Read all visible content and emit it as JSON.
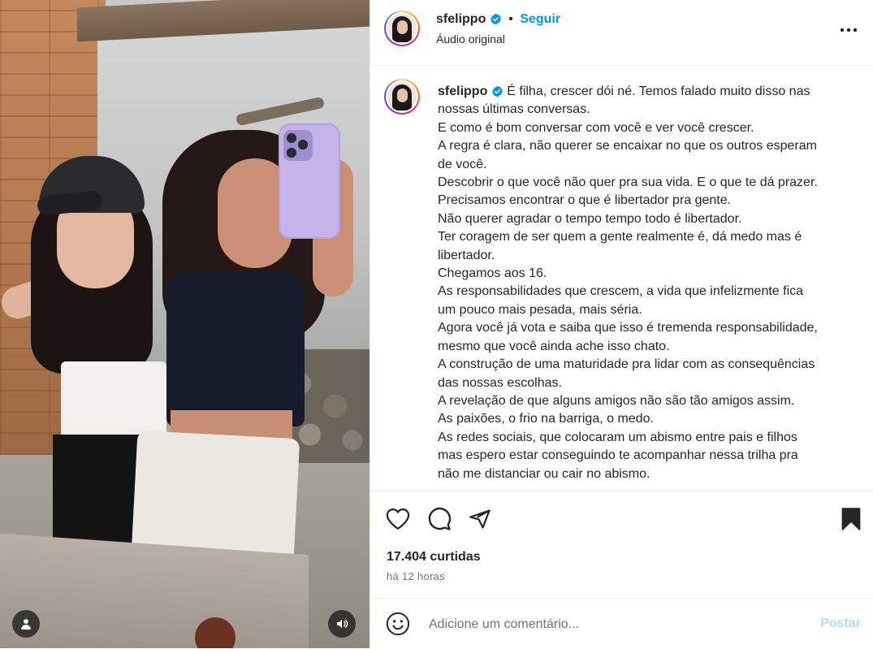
{
  "post": {
    "author": "sfelippo",
    "follow_label": "Seguir",
    "audio": "Áudio original",
    "more_label": "•••"
  },
  "caption": {
    "author": "sfelippo",
    "lines": [
      "É filha, crescer dói né. Temos falado muito disso nas",
      "nossas últimas conversas.",
      "E como é bom conversar com você e ver você crescer.",
      "A regra é clara, não querer se encaixar no que os outros esperam",
      "de você.",
      "Descobrir o que você não quer pra sua vida. E o que te dá prazer.",
      "Precisamos encontrar o que é libertador pra gente.",
      "Não querer agradar o tempo tempo todo é libertador.",
      "Ter coragem de ser quem a gente realmente é, dá medo mas é",
      "libertador.",
      "Chegamos aos 16.",
      "As responsabilidades que crescem, a vida que infelizmente fica",
      "um pouco mais pesada, mais séria.",
      "Agora você já vota e saiba que isso é tremenda responsabilidade,",
      "mesmo que você ainda ache isso chato.",
      "A construção de uma maturidade pra lidar com as consequências",
      "das nossas escolhas.",
      "A revelação de que alguns amigos não são tão amigos assim.",
      "As paixões, o frio na barriga, o medo.",
      "As redes sociais, que colocaram um abismo entre pais e filhos",
      "mas espero estar conseguindo te acompanhar nessa trilha pra",
      "não me distanciar ou cair no abismo."
    ]
  },
  "stats": {
    "likes": "17.404 curtidas",
    "time": "há 12 horas"
  },
  "comment": {
    "placeholder": "Adicione um comentário...",
    "post_label": "Postar"
  },
  "colors": {
    "accent": "#0095f6",
    "post_disabled": "#b3dbff",
    "text": "#262626",
    "muted": "#737373",
    "border": "#efefef"
  }
}
